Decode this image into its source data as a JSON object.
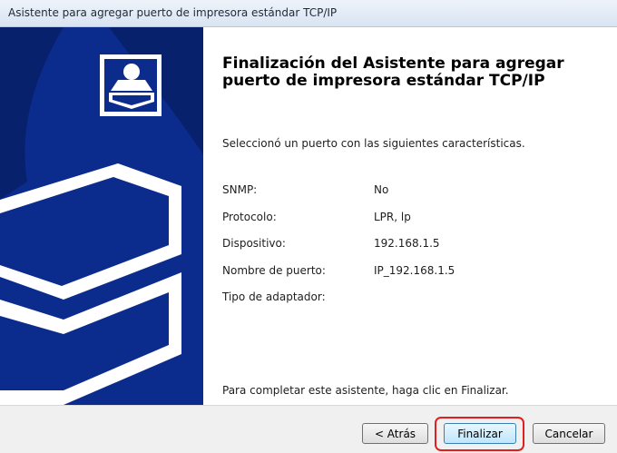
{
  "window": {
    "title": "Asistente para agregar puerto de impresora estándar TCP/IP"
  },
  "main": {
    "heading": "Finalización del Asistente para agregar puerto de impresora estándar TCP/IP",
    "intro": "Seleccionó un puerto con las siguientes características.",
    "properties": [
      {
        "label": "SNMP:",
        "value": "No"
      },
      {
        "label": "Protocolo:",
        "value": "LPR, lp"
      },
      {
        "label": "Dispositivo:",
        "value": "192.168.1.5"
      },
      {
        "label": "Nombre de puerto:",
        "value": "IP_192.168.1.5"
      },
      {
        "label": "Tipo de adaptador:",
        "value": ""
      }
    ],
    "finish_note": "Para completar este asistente, haga clic en Finalizar."
  },
  "buttons": {
    "back": "< Atrás",
    "finish": "Finalizar",
    "cancel": "Cancelar"
  },
  "colors": {
    "sidebar": "#0b2c8c",
    "highlight": "#e02020"
  },
  "icons": {
    "wizard_banner": "printer-wizard-icon"
  }
}
